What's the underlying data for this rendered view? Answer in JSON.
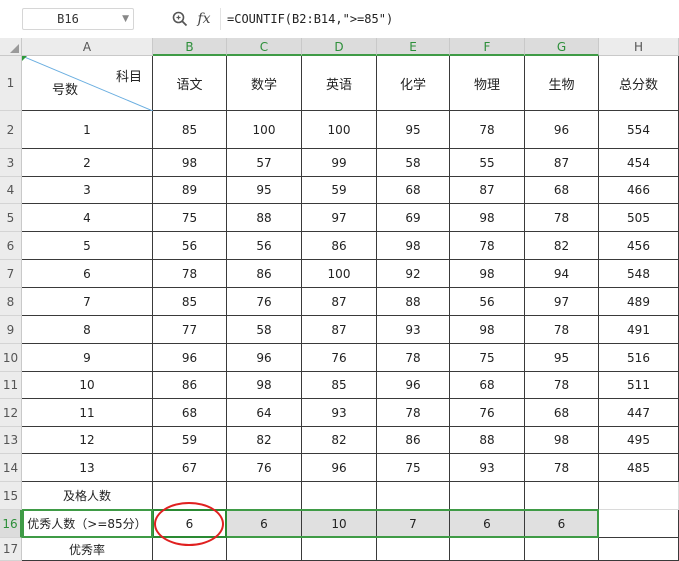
{
  "formula_bar": {
    "cell_ref": "B16",
    "fx_label": "fx",
    "formula": "=COUNTIF(B2:B14,\">=85\")"
  },
  "columns": [
    "A",
    "B",
    "C",
    "D",
    "E",
    "F",
    "G",
    "H"
  ],
  "rows": [
    "1",
    "2",
    "3",
    "4",
    "5",
    "6",
    "7",
    "8",
    "9",
    "10",
    "11",
    "12",
    "13",
    "14",
    "15",
    "16",
    "17"
  ],
  "header_row": {
    "diag_top": "科目",
    "diag_bottom": "号数",
    "subjects": [
      "语文",
      "数学",
      "英语",
      "化学",
      "物理",
      "生物"
    ],
    "total": "总分数"
  },
  "data_rows": [
    {
      "id": "1",
      "scores": [
        "85",
        "100",
        "100",
        "95",
        "78",
        "96"
      ],
      "total": "554"
    },
    {
      "id": "2",
      "scores": [
        "98",
        "57",
        "99",
        "58",
        "55",
        "87"
      ],
      "total": "454"
    },
    {
      "id": "3",
      "scores": [
        "89",
        "95",
        "59",
        "68",
        "87",
        "68"
      ],
      "total": "466"
    },
    {
      "id": "4",
      "scores": [
        "75",
        "88",
        "97",
        "69",
        "98",
        "78"
      ],
      "total": "505"
    },
    {
      "id": "5",
      "scores": [
        "56",
        "56",
        "86",
        "98",
        "78",
        "82"
      ],
      "total": "456"
    },
    {
      "id": "6",
      "scores": [
        "78",
        "86",
        "100",
        "92",
        "98",
        "94"
      ],
      "total": "548"
    },
    {
      "id": "7",
      "scores": [
        "85",
        "76",
        "87",
        "88",
        "56",
        "97"
      ],
      "total": "489"
    },
    {
      "id": "8",
      "scores": [
        "77",
        "58",
        "87",
        "93",
        "98",
        "78"
      ],
      "total": "491"
    },
    {
      "id": "9",
      "scores": [
        "96",
        "96",
        "76",
        "78",
        "75",
        "95"
      ],
      "total": "516"
    },
    {
      "id": "10",
      "scores": [
        "86",
        "98",
        "85",
        "96",
        "68",
        "78"
      ],
      "total": "511"
    },
    {
      "id": "11",
      "scores": [
        "68",
        "64",
        "93",
        "78",
        "76",
        "68"
      ],
      "total": "447"
    },
    {
      "id": "12",
      "scores": [
        "59",
        "82",
        "82",
        "86",
        "88",
        "98"
      ],
      "total": "495"
    },
    {
      "id": "13",
      "scores": [
        "67",
        "76",
        "96",
        "75",
        "93",
        "78"
      ],
      "total": "485"
    }
  ],
  "summary_rows": {
    "pass_label": "及格人数",
    "excellent_label": "优秀人数（>=85分）",
    "excellent_values": [
      "6",
      "6",
      "10",
      "7",
      "6",
      "6"
    ],
    "rate_label": "优秀率"
  },
  "colors": {
    "selection_green": "#3f9b46",
    "highlight_circle": "#e02020",
    "selected_row_fill": "#e0e0e0"
  }
}
